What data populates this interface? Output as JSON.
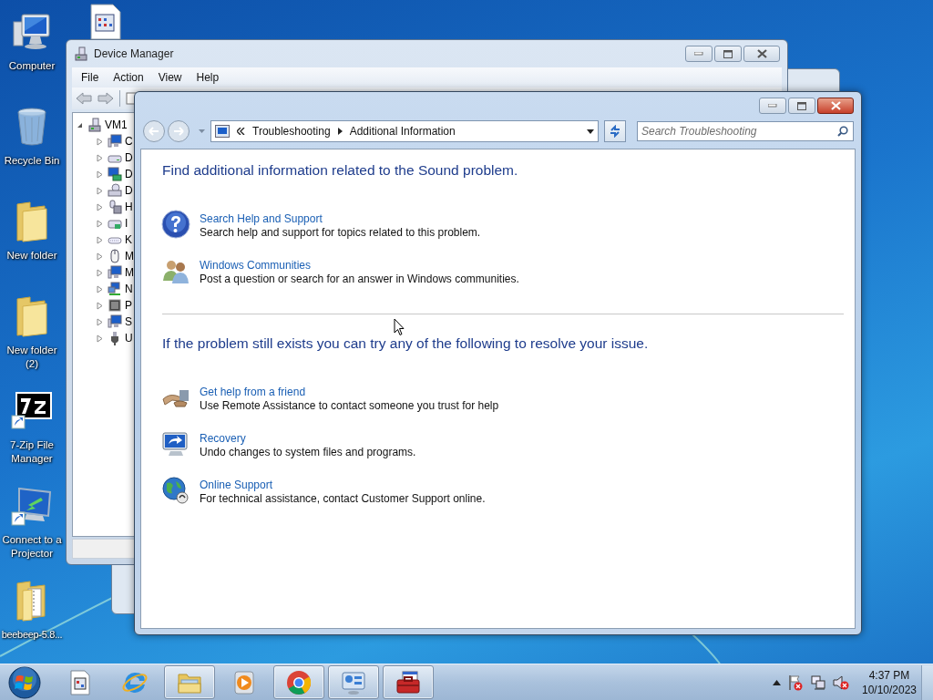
{
  "desktop_icons": [
    {
      "kind": "computer",
      "label": "Computer"
    },
    {
      "kind": "recycle-bin",
      "label": "Recycle Bin"
    },
    {
      "kind": "folder",
      "label": "New folder"
    },
    {
      "kind": "folder",
      "label": "New folder (2)"
    },
    {
      "kind": "archiver",
      "label": "7-Zip File Manager"
    },
    {
      "kind": "projector",
      "label": "Connect to a Projector"
    },
    {
      "kind": "zip-folder",
      "label": "beebeep-5.8..."
    }
  ],
  "device_manager": {
    "title": "Device Manager",
    "menu": [
      "File",
      "Action",
      "View",
      "Help"
    ],
    "tree": {
      "label": "VM1",
      "kind": "computer",
      "expanded": true,
      "children": [
        {
          "label": "C",
          "kind": "monitor",
          "expanded": false
        },
        {
          "label": "D",
          "kind": "drive",
          "expanded": false
        },
        {
          "label": "D",
          "kind": "display",
          "expanded": false
        },
        {
          "label": "D",
          "kind": "dvd",
          "expanded": false
        },
        {
          "label": "H",
          "kind": "hid",
          "expanded": false
        },
        {
          "label": "I",
          "kind": "controller",
          "expanded": false
        },
        {
          "label": "K",
          "kind": "keyboard",
          "expanded": false
        },
        {
          "label": "M",
          "kind": "mouse",
          "expanded": false
        },
        {
          "label": "M",
          "kind": "monitor",
          "expanded": false
        },
        {
          "label": "N",
          "kind": "network",
          "expanded": false
        },
        {
          "label": "P",
          "kind": "processor",
          "expanded": false
        },
        {
          "label": "S",
          "kind": "monitor",
          "expanded": false
        },
        {
          "label": "U",
          "kind": "usb",
          "expanded": false
        }
      ]
    }
  },
  "troubleshooter": {
    "breadcrumb": [
      "Troubleshooting",
      "Additional Information"
    ],
    "search": {
      "placeholder": "Search Troubleshooting"
    },
    "sections": [
      {
        "heading": "Find additional information related to the Sound problem.",
        "links": [
          {
            "kind": "help",
            "title": "Search Help and Support",
            "description": "Search help and support for topics related to this problem."
          },
          {
            "kind": "people",
            "title": "Windows Communities",
            "description": "Post a question or search for an answer in Windows communities."
          }
        ]
      },
      {
        "heading": "If the problem still exists you can try any of the following to resolve your issue.",
        "links": [
          {
            "kind": "remote",
            "title": "Get help from a friend",
            "description": "Use Remote Assistance to contact someone you trust for help"
          },
          {
            "kind": "recovery",
            "title": "Recovery",
            "description": "Undo changes to system files and programs."
          },
          {
            "kind": "globe",
            "title": "Online Support",
            "description": "For technical assistance, contact Customer Support online."
          }
        ]
      }
    ]
  },
  "taskbar": {
    "items": [
      {
        "kind": "notepad",
        "running": false
      },
      {
        "kind": "browser",
        "running": false
      },
      {
        "kind": "explorer",
        "running": true
      },
      {
        "kind": "media",
        "running": false
      },
      {
        "kind": "chrome",
        "running": true
      },
      {
        "kind": "control-panel",
        "running": true
      },
      {
        "kind": "toolbox",
        "running": true
      }
    ],
    "clock": {
      "time": "4:37 PM",
      "date": "10/10/2023"
    }
  }
}
